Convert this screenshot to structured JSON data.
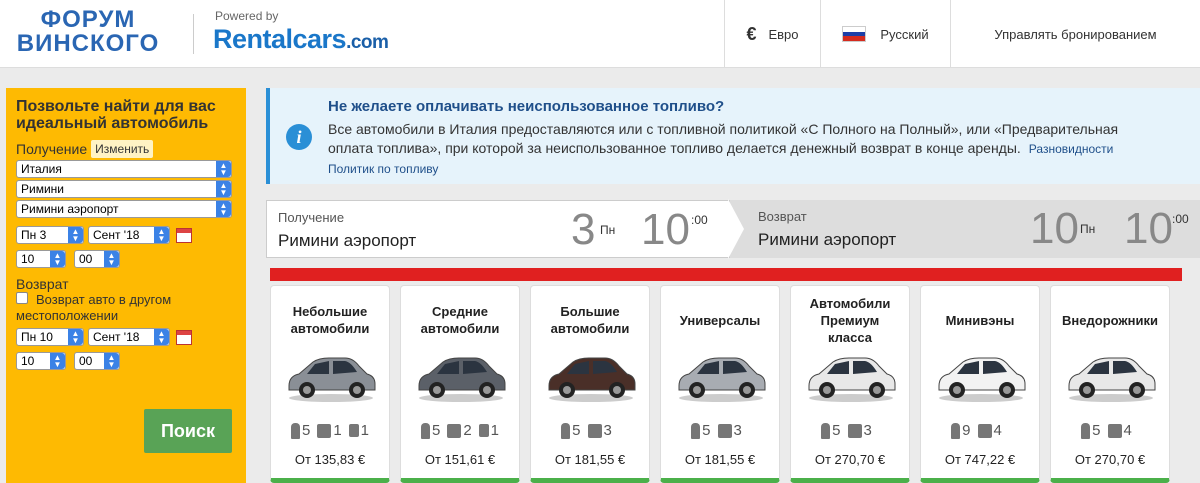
{
  "header": {
    "logo_line1": "ФОРУМ",
    "logo_line2": "ВИНСКОГО",
    "powered_by": "Powered by",
    "rentalcars": "Rentalcars",
    "rentalcars_com": ".com",
    "currency_symbol": "€",
    "currency": "Евро",
    "language": "Русский",
    "manage": "Управлять бронированием",
    "flag_colors": [
      "#ffffff",
      "#1c3fa8",
      "#d52b1e"
    ]
  },
  "sidebar": {
    "title": "Позвольте найти для вас идеальный автомобиль",
    "pickup_label": "Получение",
    "change_label": "Изменить",
    "country": "Италия",
    "city": "Римини",
    "location": "Римини аэропорт",
    "pickup_day": "Пн 3",
    "pickup_month": "Сент '18",
    "pickup_hour": "10",
    "pickup_min": "00",
    "return_label": "Возврат",
    "return_other": "Возврат авто в другом местоположении",
    "return_day": "Пн 10",
    "return_month": "Сент '18",
    "return_hour": "10",
    "return_min": "00",
    "search_label": "Поиск"
  },
  "info": {
    "title": "Не желаете оплачивать неиспользованное топливо?",
    "body": "Все автомобили в Италия предоставляются или с топливной политикой «С Полного на Полный», или «Предварительная оплата топлива», при которой за неиспользованное топливо делается денежный возврат в конце аренды.",
    "link": "Разновидности Политик по топливу"
  },
  "dates": {
    "pickup_label": "Получение",
    "pickup_place": "Римини аэропорт",
    "pickup_day_num": "3",
    "pickup_weekday": "Пн",
    "pickup_hour": "10",
    "pickup_min": ":00",
    "return_label": "Возврат",
    "return_place": "Римини аэропорт",
    "return_day_num": "10",
    "return_weekday": "Пн",
    "return_hour": "10",
    "return_min": ":00"
  },
  "cards": [
    {
      "title": "Небольшие автомобили",
      "seats": "5",
      "bags": "1",
      "small_bags": "1",
      "price": "От 135,83 €",
      "color": "#8a8f96"
    },
    {
      "title": "Средние автомобили",
      "seats": "5",
      "bags": "2",
      "small_bags": "1",
      "price": "От 151,61 €",
      "color": "#5b6068"
    },
    {
      "title": "Большие автомобили",
      "seats": "5",
      "bags": "3",
      "small_bags": "",
      "price": "От 181,55 €",
      "color": "#4a2f28"
    },
    {
      "title": "Универсалы",
      "seats": "5",
      "bags": "3",
      "small_bags": "",
      "price": "От 181,55 €",
      "color": "#a8acb2"
    },
    {
      "title": "Автомобили Премиум класса",
      "seats": "5",
      "bags": "3",
      "small_bags": "",
      "price": "От 270,70 €",
      "color": "#e8e8e8"
    },
    {
      "title": "Минивэны",
      "seats": "9",
      "bags": "4",
      "small_bags": "",
      "price": "От 747,22 €",
      "color": "#f2f2f2"
    },
    {
      "title": "Внедорожники",
      "seats": "5",
      "bags": "4",
      "small_bags": "",
      "price": "От 270,70 €",
      "color": "#e8e8e8"
    }
  ]
}
